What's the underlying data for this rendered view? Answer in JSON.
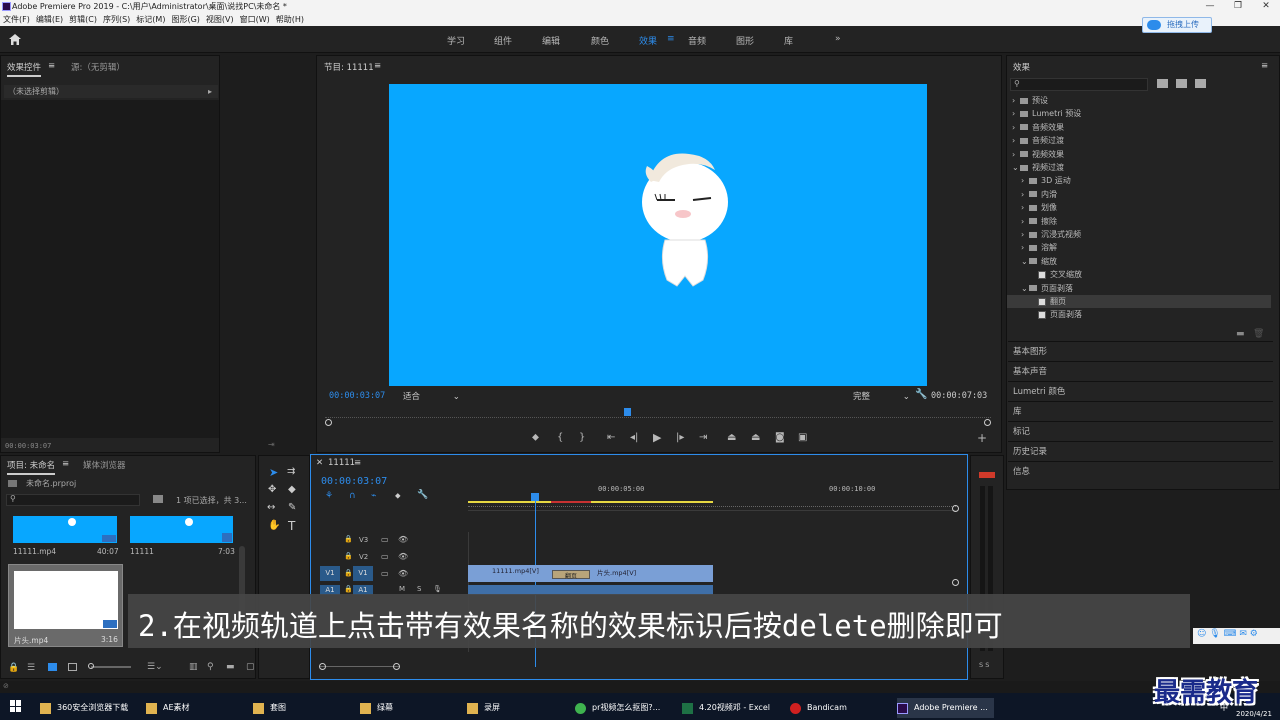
{
  "window": {
    "title": "Adobe Premiere Pro 2019 - C:\\用户\\Administrator\\桌面\\说找PC\\未命名 *",
    "controls": [
      "—",
      "❐",
      "✕"
    ]
  },
  "menu": [
    "文件(F)",
    "编辑(E)",
    "剪辑(C)",
    "序列(S)",
    "标记(M)",
    "图形(G)",
    "视图(V)",
    "窗口(W)",
    "帮助(H)"
  ],
  "workspaces": {
    "items": [
      "学习",
      "组件",
      "编辑",
      "颜色",
      "效果",
      "音频",
      "图形",
      "库"
    ],
    "active": "效果",
    "more": "»"
  },
  "upload_button": "拖拽上传",
  "effect_controls": {
    "tab": "效果控件",
    "source": "源:（无剪辑）",
    "no_clip": "（未选择剪辑）",
    "timecode": "00:00:03:07"
  },
  "program": {
    "title": "节目: 11111",
    "timecode": "00:00:03:07",
    "fit": "适合",
    "quality": "完整",
    "duration": "00:00:07:03"
  },
  "effects": {
    "title": "效果",
    "tree": [
      {
        "label": "预设",
        "level": 0,
        "open": false
      },
      {
        "label": "Lumetri 预设",
        "level": 0,
        "open": false
      },
      {
        "label": "音频效果",
        "level": 0,
        "open": false
      },
      {
        "label": "音频过渡",
        "level": 0,
        "open": false
      },
      {
        "label": "视频效果",
        "level": 0,
        "open": false
      },
      {
        "label": "视频过渡",
        "level": 0,
        "open": true
      },
      {
        "label": "3D 运动",
        "level": 1,
        "open": false
      },
      {
        "label": "内滑",
        "level": 1,
        "open": false
      },
      {
        "label": "划像",
        "level": 1,
        "open": false
      },
      {
        "label": "擦除",
        "level": 1,
        "open": false
      },
      {
        "label": "沉浸式视频",
        "level": 1,
        "open": false
      },
      {
        "label": "溶解",
        "level": 1,
        "open": false
      },
      {
        "label": "缩放",
        "level": 1,
        "open": true
      },
      {
        "label": "交叉缩放",
        "level": 2,
        "fx": true
      },
      {
        "label": "页面剥落",
        "level": 1,
        "open": true
      },
      {
        "label": "翻页",
        "level": 2,
        "fx": true,
        "selected": true
      },
      {
        "label": "页面剥落",
        "level": 2,
        "fx": true
      }
    ],
    "sections": [
      "基本图形",
      "基本声音",
      "Lumetri 颜色",
      "库",
      "标记",
      "历史记录",
      "信息"
    ]
  },
  "project": {
    "tab": "项目: 未命名",
    "tab2": "媒体浏览器",
    "file": "未命名.prproj",
    "selection": "1 项已选择，共 3...",
    "items": [
      {
        "name": "11111.mp4",
        "duration": "40:07"
      },
      {
        "name": "11111",
        "duration": "7:03"
      },
      {
        "name": "片头.mp4",
        "duration": "3:16"
      }
    ]
  },
  "timeline": {
    "tab": "11111",
    "timecode": "00:00:03:07",
    "ruler": [
      "00:00:05:00",
      "00:00:10:00"
    ],
    "tracks": [
      "V3",
      "V2",
      "V1",
      "A1"
    ],
    "clips": [
      {
        "label": "11111.mp4[V]"
      },
      {
        "label": "翻页"
      },
      {
        "label": "片头.mp4[V]"
      }
    ]
  },
  "meter_label": "S S",
  "caption": "2.在视频轨道上点击带有效果名称的效果标识后按delete删除即可",
  "watermark": "最需教育",
  "taskbar": {
    "items": [
      "360安全浏览器下载",
      "AE素材",
      "套图",
      "绿幕",
      "录屏",
      "pr视频怎么抠图?...",
      "4.20视频邓 - Excel",
      "Bandicam",
      "Adobe Premiere ..."
    ],
    "ime": "中",
    "date": "2020/4/21"
  },
  "colors": {
    "accent": "#2d8ceb",
    "video_bg": "#08a7ff",
    "clip": "#7a9fd6"
  }
}
